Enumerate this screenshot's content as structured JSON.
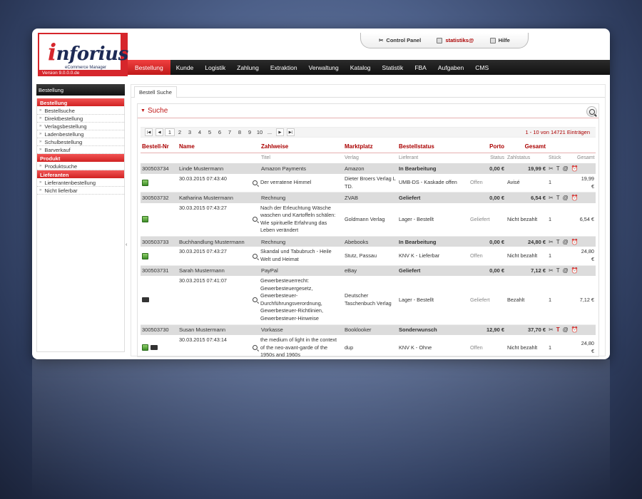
{
  "logo": {
    "brand": "inforius",
    "subtitle": "eCommerce Manager",
    "version": "Version 9.0.0.0.de"
  },
  "topbar": {
    "control_panel": "Control Panel",
    "user": "statistiks@",
    "help": "Hilfe"
  },
  "nav": [
    "Bestellung",
    "Kunde",
    "Logistik",
    "Zahlung",
    "Extraktion",
    "Verwaltung",
    "Katalog",
    "Statistik",
    "FBA",
    "Aufgaben",
    "CMS"
  ],
  "sidebar": {
    "header": "Bestellung",
    "groups": [
      {
        "title": "Bestellung",
        "items": [
          "Bestellsuche",
          "Direktbestellung",
          "Verlagsbestellung",
          "Ladenbestellung",
          "Schulbestellung",
          "Barverkauf"
        ]
      },
      {
        "title": "Produkt",
        "items": [
          "Produktsuche"
        ]
      },
      {
        "title": "Lieferanten",
        "items": [
          "Lieferantenbestellung",
          "Nicht lieferbar"
        ]
      }
    ]
  },
  "content": {
    "tab": "Bestell Suche",
    "search_title": "Suche",
    "pager": {
      "pages": [
        "1",
        "2",
        "3",
        "4",
        "5",
        "6",
        "7",
        "8",
        "9",
        "10",
        "..."
      ],
      "current": "1",
      "info": "1 - 10 von 14721 Einträgen"
    },
    "columns": {
      "main": [
        "Bestell-Nr",
        "Name",
        "Zahlweise",
        "Marktplatz",
        "Bestellstatus",
        "Porto",
        "Gesamt"
      ],
      "sub": [
        "Titel",
        "Verlag",
        "Lieferant",
        "Status",
        "Zahlstatus",
        "Stück",
        "Gesamt"
      ]
    },
    "orders": [
      {
        "nr": "300503734",
        "name": "Linde Mustermann",
        "zahlweise": "Amazon Payments",
        "markt": "Amazon",
        "status": "In Bearbeitung",
        "porto": "0,00 €",
        "gesamt": "19,99 €",
        "date": "30.03.2015 07:43:40",
        "titel": "Der verratene Himmel",
        "verlag": "Dieter Broers Verlag L TD.",
        "lieferant": "UMB-DS - Kaskade offen",
        "istatus": "Offen",
        "zahlstatus": "Avisé",
        "stueck": "1",
        "igesamt": "19,99 €"
      },
      {
        "nr": "300503732",
        "name": "Katharina Mustermann",
        "zahlweise": "Rechnung",
        "markt": "ZVAB",
        "status": "Geliefert",
        "porto": "0,00 €",
        "gesamt": "6,54 €",
        "date": "30.03.2015 07:43:27",
        "titel": "Nach der Erleuchtung Wäsche waschen und Kartoffeln schälen: Wie spirituelle Erfahrung das Leben verändert",
        "verlag": "Goldmann Verlag",
        "lieferant": "Lager - Bestellt",
        "istatus": "Geliefert",
        "zahlstatus": "Nicht bezahlt",
        "stueck": "1",
        "igesamt": "6,54 €"
      },
      {
        "nr": "300503733",
        "name": "Buchhandlung Mustermann",
        "zahlweise": "Rechnung",
        "markt": "Abebooks",
        "status": "In Bearbeitung",
        "porto": "0,00 €",
        "gesamt": "24,80 €",
        "date": "30.03.2015 07:43:27",
        "titel": "Skandal und Tabubruch - Heile Welt und Heimat",
        "verlag": "Stutz, Passau",
        "lieferant": "KNV K - Lieferbar",
        "istatus": "Offen",
        "zahlstatus": "Nicht bezahlt",
        "stueck": "1",
        "igesamt": "24,80 €"
      },
      {
        "nr": "300503731",
        "name": "Sarah Mustermann",
        "zahlweise": "PayPal",
        "markt": "eBay",
        "status": "Geliefert",
        "porto": "0,00 €",
        "gesamt": "7,12 €",
        "date": "30.03.2015 07:41:07",
        "titel": "Gewerbesteuerrecht: Gewerbesteuergesetz, Gewerbesteuer-Durchführungsverordnung, Gewerbesteuer-Richtlinien, Gewerbesteuer-Hinweise",
        "verlag": "Deutscher Taschenbuch Verlag",
        "lieferant": "Lager - Bestellt",
        "istatus": "Geliefert",
        "zahlstatus": "Bezahlt",
        "stueck": "1",
        "igesamt": "7,12 €"
      },
      {
        "nr": "300503730",
        "name": "Susan Mustermann",
        "zahlweise": "Vorkasse",
        "markt": "Booklooker",
        "status": "Sonderwunsch",
        "porto": "12,90 €",
        "gesamt": "37,70 €",
        "date": "30.03.2015 07:43:14",
        "titel": "the medium of light in the context of the neo-avant-garde of the 1950s and 1960s",
        "verlag": "dup",
        "lieferant": "KNV K - Ohne",
        "istatus": "Offen",
        "zahlstatus": "Nicht bezahlt",
        "stueck": "1",
        "igesamt": "24,80 €"
      }
    ]
  }
}
